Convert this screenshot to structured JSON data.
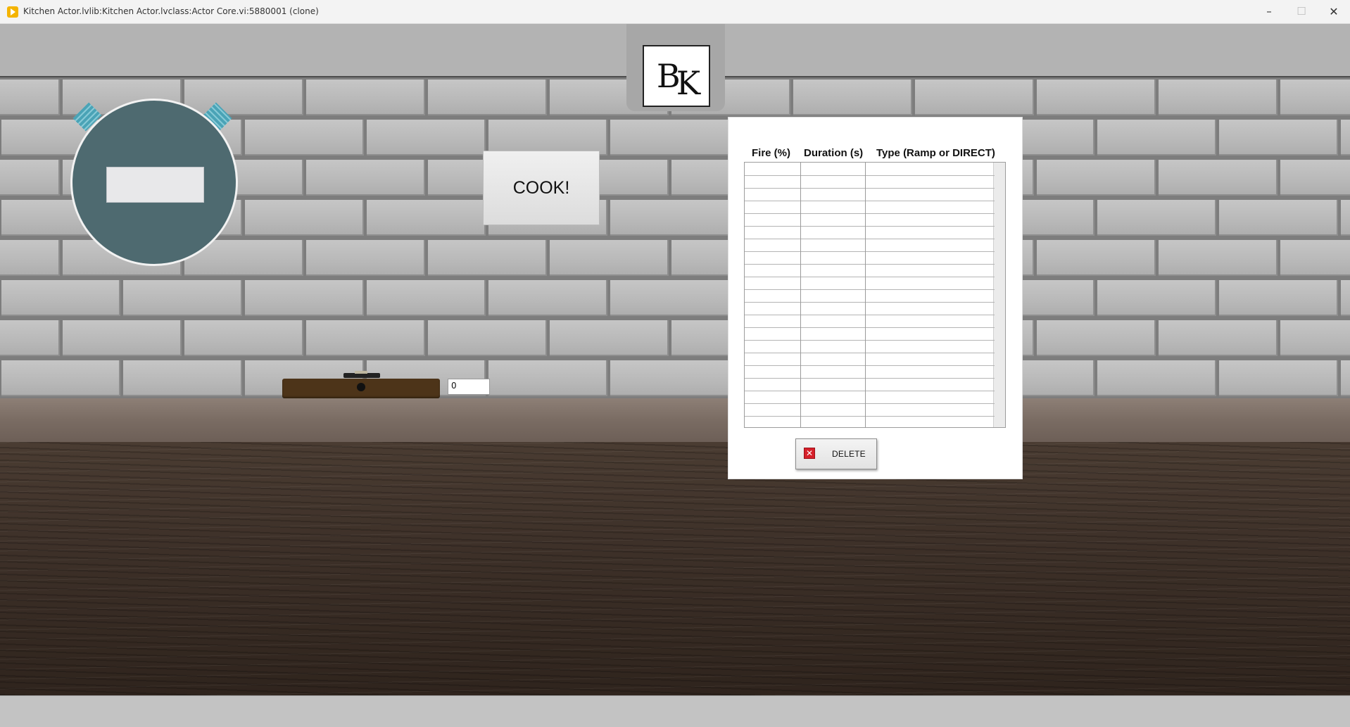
{
  "window": {
    "title": "Kitchen Actor.lvlib:Kitchen Actor.lvclass:Actor Core.vi:5880001 (clone)",
    "minimize_glyph": "–",
    "maximize_glyph": "☐",
    "close_glyph": "✕"
  },
  "logo": {
    "letter1": "B",
    "letter2": "K"
  },
  "timer": {
    "display_value": ""
  },
  "cook_button": {
    "label": "COOK!"
  },
  "stove_knob": {
    "value": "0"
  },
  "recipe_table": {
    "headers": [
      "Fire (%)",
      "Duration (s)",
      "Type (Ramp or DIRECT)"
    ],
    "rows": [
      [
        "",
        "",
        ""
      ],
      [
        "",
        "",
        ""
      ],
      [
        "",
        "",
        ""
      ],
      [
        "",
        "",
        ""
      ],
      [
        "",
        "",
        ""
      ],
      [
        "",
        "",
        ""
      ],
      [
        "",
        "",
        ""
      ],
      [
        "",
        "",
        ""
      ],
      [
        "",
        "",
        ""
      ],
      [
        "",
        "",
        ""
      ],
      [
        "",
        "",
        ""
      ],
      [
        "",
        "",
        ""
      ],
      [
        "",
        "",
        ""
      ],
      [
        "",
        "",
        ""
      ],
      [
        "",
        "",
        ""
      ],
      [
        "",
        "",
        ""
      ],
      [
        "",
        "",
        ""
      ],
      [
        "",
        "",
        ""
      ],
      [
        "",
        "",
        ""
      ],
      [
        "",
        "",
        ""
      ]
    ]
  },
  "delete_button": {
    "label": "DELETE",
    "icon_glyph": "✕",
    "icon": "red-x-icon",
    "icon_color": "#d6202a"
  },
  "colors": {
    "timer_face": "#4e6a70",
    "timer_ears": "#4aa3b6",
    "brick": "#bdbdbd",
    "mortar": "#7d7d7d",
    "knob_panel": "#4d3419",
    "table_wood": "#3e3129"
  }
}
